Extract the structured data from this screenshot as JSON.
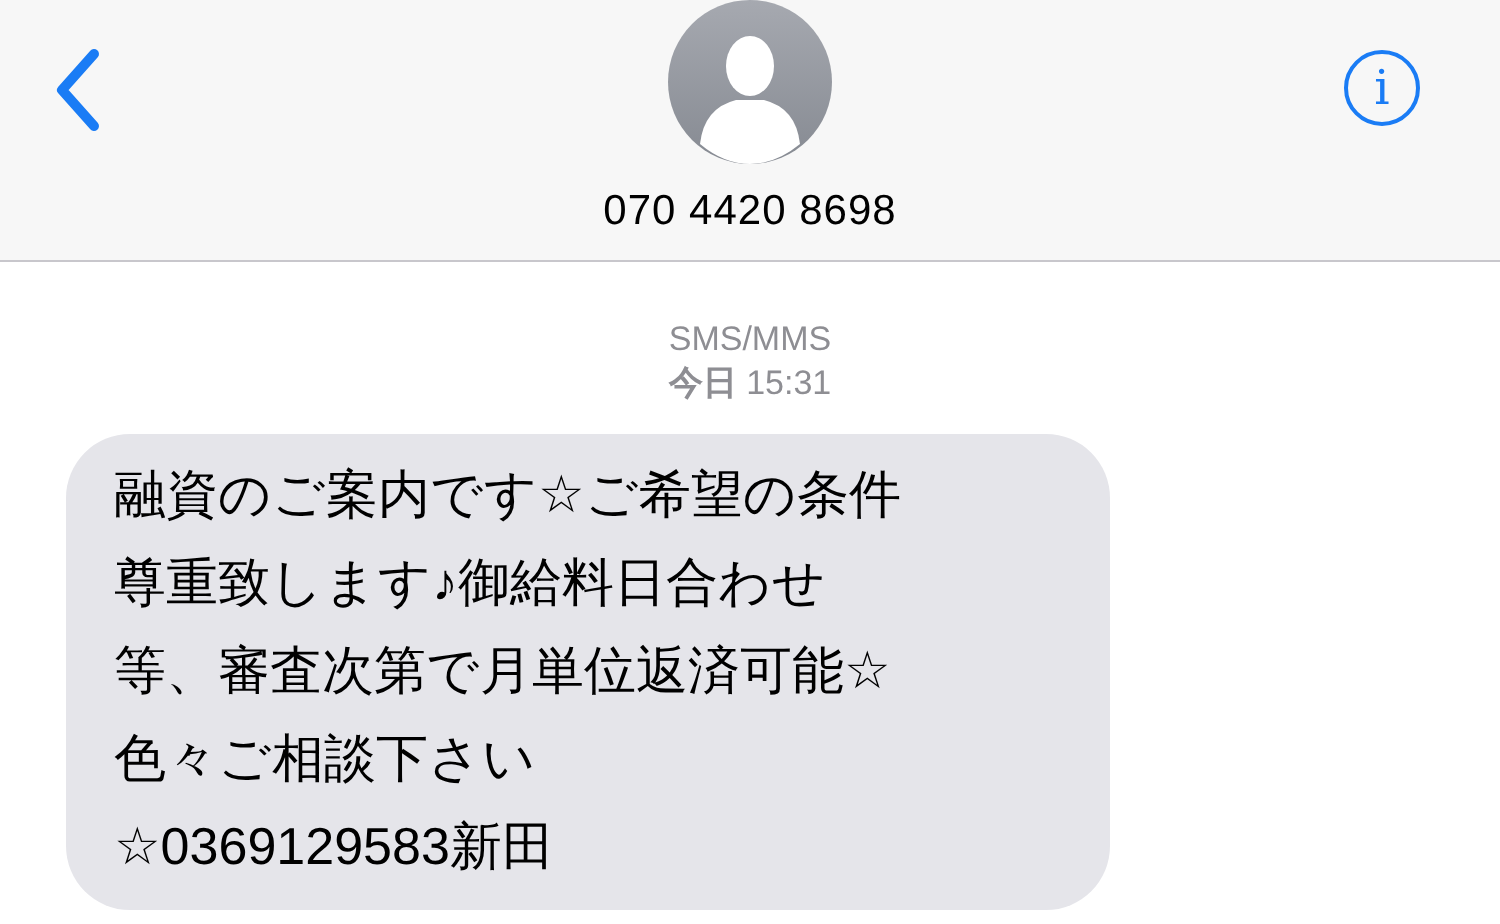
{
  "header": {
    "contact": "070 4420 8698",
    "info": "i"
  },
  "thread": {
    "service": "SMS/MMS",
    "timestamp": "**今日** 15:31"
  },
  "messages": [
    {
      "kind": "incoming",
      "paragraphs": [
        "融資のご案内です☆ご希望の条件尊重致します♪御給料日合わせ等、審査次第で月単位返済可能☆色々ご相談下さい",
        "☆0369129583新田"
      ]
    }
  ]
}
